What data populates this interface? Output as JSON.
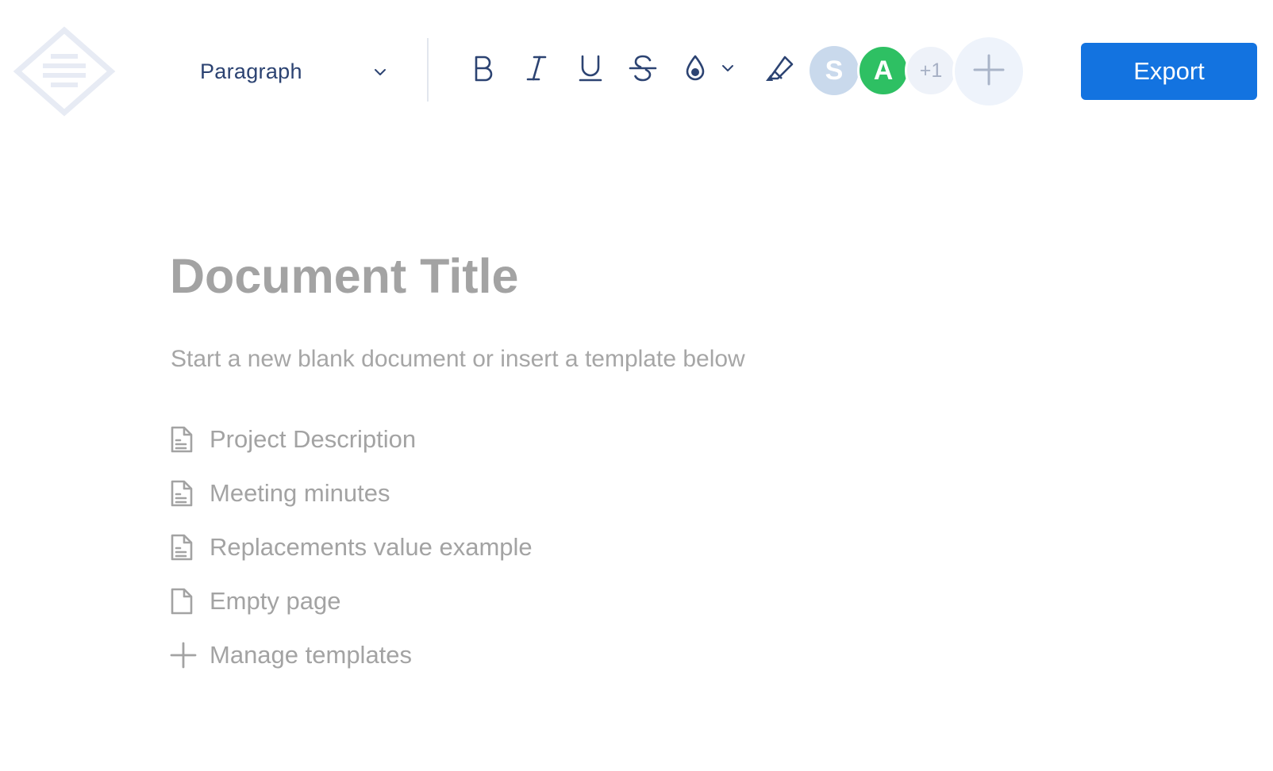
{
  "toolbar": {
    "format_select": {
      "value": "Paragraph"
    },
    "tools": [
      {
        "name": "bold",
        "icon": "bold-icon"
      },
      {
        "name": "italic",
        "icon": "italic-icon"
      },
      {
        "name": "underline",
        "icon": "underline-icon"
      },
      {
        "name": "strikethrough",
        "icon": "strikethrough-icon"
      },
      {
        "name": "text-color",
        "icon": "ink-drop-icon"
      },
      {
        "name": "text-color-dropdown",
        "icon": "chevron-down-icon"
      },
      {
        "name": "highlight",
        "icon": "highlighter-icon"
      }
    ],
    "collaborators": [
      {
        "initial": "S",
        "color": "#c9d9ec"
      },
      {
        "initial": "A",
        "color": "#2ec063"
      }
    ],
    "more_collaborators": "+1",
    "add_collaborator_icon": "plus-icon",
    "export_label": "Export",
    "accent_color": "#1373e0",
    "icon_color": "#2c4372"
  },
  "document": {
    "title_placeholder": "Document Title",
    "subtitle": "Start a new blank document or insert a template below",
    "templates": [
      {
        "label": "Project Description",
        "icon": "document-text-icon"
      },
      {
        "label": "Meeting minutes",
        "icon": "document-text-icon"
      },
      {
        "label": "Replacements value example",
        "icon": "document-text-icon"
      },
      {
        "label": "Empty page",
        "icon": "blank-page-icon"
      },
      {
        "label": "Manage templates",
        "icon": "plus-icon"
      }
    ]
  }
}
